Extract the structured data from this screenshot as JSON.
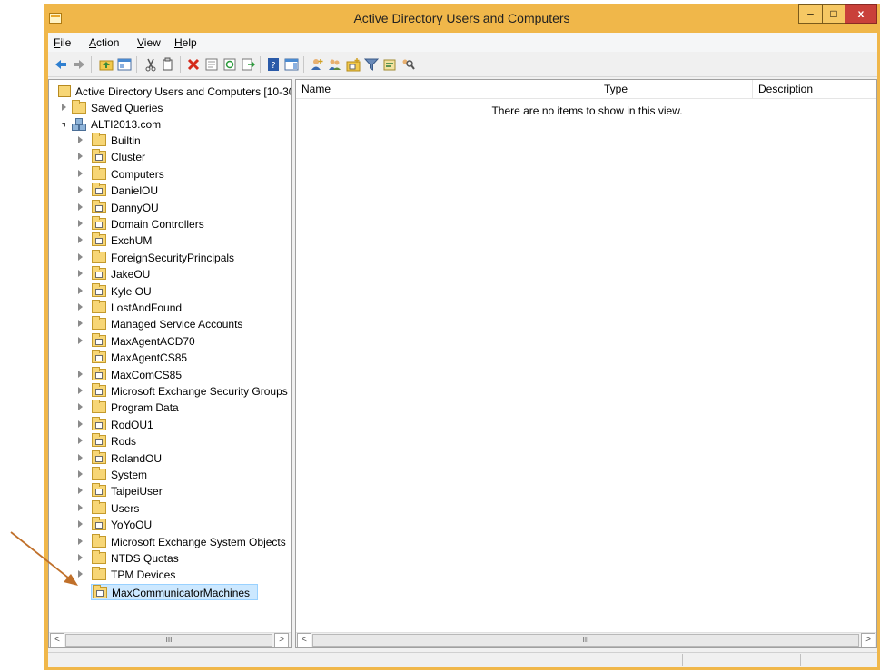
{
  "window": {
    "title": "Active Directory Users and Computers"
  },
  "window_buttons": {
    "minimize": "‒",
    "maximize": "□",
    "close": "x"
  },
  "menu": [
    {
      "label": "File",
      "key": "F",
      "rest": "ile"
    },
    {
      "label": "Action",
      "key": "A",
      "rest": "ction"
    },
    {
      "label": "View",
      "key": "V",
      "rest": "iew"
    },
    {
      "label": "Help",
      "key": "H",
      "rest": "elp"
    }
  ],
  "toolbar_icons": [
    "back-arrow-icon",
    "forward-arrow-icon",
    "up-folder-icon",
    "show-hide-console-tree-icon",
    "cut-icon",
    "copy-icon",
    "delete-icon",
    "properties-icon",
    "refresh-icon",
    "export-list-icon",
    "help-icon",
    "show-action-pane-icon",
    "new-user-icon",
    "new-group-icon",
    "new-ou-icon",
    "filter-icon",
    "add-to-group-icon",
    "find-icon"
  ],
  "tree": {
    "root": "Active Directory Users and Computers [10-30",
    "saved_queries": "Saved Queries",
    "domain": "ALTI2013.com",
    "items": [
      {
        "label": "Builtin",
        "ou": false,
        "expander": true
      },
      {
        "label": "Cluster",
        "ou": true,
        "expander": true
      },
      {
        "label": "Computers",
        "ou": false,
        "expander": true
      },
      {
        "label": "DanielOU",
        "ou": true,
        "expander": true
      },
      {
        "label": "DannyOU",
        "ou": true,
        "expander": true
      },
      {
        "label": "Domain Controllers",
        "ou": true,
        "expander": true
      },
      {
        "label": "ExchUM",
        "ou": true,
        "expander": true
      },
      {
        "label": "ForeignSecurityPrincipals",
        "ou": false,
        "expander": true
      },
      {
        "label": "JakeOU",
        "ou": true,
        "expander": true
      },
      {
        "label": "Kyle OU",
        "ou": true,
        "expander": true
      },
      {
        "label": "LostAndFound",
        "ou": false,
        "expander": true
      },
      {
        "label": "Managed Service Accounts",
        "ou": false,
        "expander": true
      },
      {
        "label": "MaxAgentACD70",
        "ou": true,
        "expander": true
      },
      {
        "label": "MaxAgentCS85",
        "ou": true,
        "expander": false
      },
      {
        "label": "MaxComCS85",
        "ou": true,
        "expander": true
      },
      {
        "label": "Microsoft Exchange Security Groups",
        "ou": true,
        "expander": true
      },
      {
        "label": "Program Data",
        "ou": false,
        "expander": true
      },
      {
        "label": "RodOU1",
        "ou": true,
        "expander": true
      },
      {
        "label": "Rods",
        "ou": true,
        "expander": true
      },
      {
        "label": "RolandOU",
        "ou": true,
        "expander": true
      },
      {
        "label": "System",
        "ou": false,
        "expander": true
      },
      {
        "label": "TaipeiUser",
        "ou": true,
        "expander": true
      },
      {
        "label": "Users",
        "ou": false,
        "expander": true
      },
      {
        "label": "YoYoOU",
        "ou": true,
        "expander": true
      },
      {
        "label": "Microsoft Exchange System Objects",
        "ou": false,
        "expander": true
      },
      {
        "label": "NTDS Quotas",
        "ou": false,
        "expander": true
      },
      {
        "label": "TPM Devices",
        "ou": false,
        "expander": true
      },
      {
        "label": "MaxCommunicatorMachines",
        "ou": true,
        "expander": false,
        "selected": true
      }
    ]
  },
  "list": {
    "columns": [
      "Name",
      "Type",
      "Description"
    ],
    "empty_message": "There are no items to show in this view."
  },
  "scrollbar": {
    "left": "<",
    "right": ">",
    "thumb": "III"
  },
  "colors": {
    "title_bar": "#f0b74a",
    "close_button": "#c9403a",
    "selection": "#cce8ff",
    "annotation_arrow": "#c0702a"
  }
}
